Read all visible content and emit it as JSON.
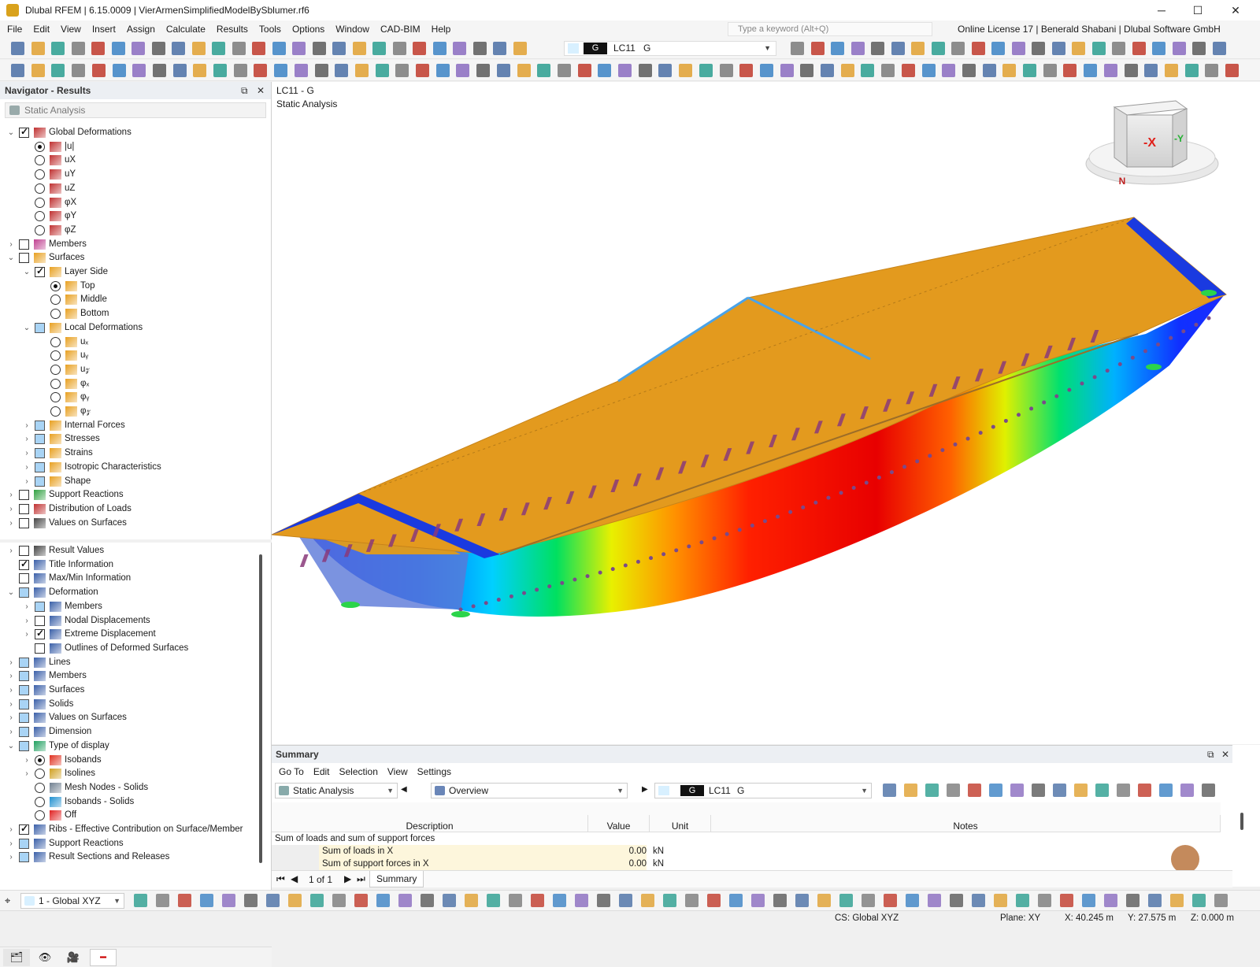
{
  "window": {
    "title": "Dlubal RFEM | 6.15.0009 | VierArmenSimplifiedModelBySblumer.rf6",
    "minimize": "─",
    "maximize": "☐",
    "close": "✕"
  },
  "menu": [
    "File",
    "Edit",
    "View",
    "Insert",
    "Assign",
    "Calculate",
    "Results",
    "Tools",
    "Options",
    "Window",
    "CAD-BIM",
    "Help"
  ],
  "search_placeholder": "Type a keyword (Alt+Q)",
  "license_text": "Online License 17 | Benerald Shabani | Dlubal Software GmbH",
  "toolbar": {
    "lc_color": "G",
    "lc_id": "LC11",
    "lc_name": "G"
  },
  "navigator": {
    "title": "Navigator - Results",
    "combo": "Static Analysis",
    "tree_top": [
      {
        "label": "Global Deformations",
        "level": 0,
        "exp": "v",
        "ctrl": "cb-on",
        "icon": "deformation-icon"
      },
      {
        "label": "|u|",
        "level": 1,
        "ctrl": "rb-on",
        "icon": "deformation-icon"
      },
      {
        "label": "uX",
        "level": 1,
        "ctrl": "rb",
        "icon": "deformation-icon"
      },
      {
        "label": "uY",
        "level": 1,
        "ctrl": "rb",
        "icon": "deformation-icon"
      },
      {
        "label": "uZ",
        "level": 1,
        "ctrl": "rb",
        "icon": "deformation-icon"
      },
      {
        "label": "φX",
        "level": 1,
        "ctrl": "rb",
        "icon": "deformation-icon"
      },
      {
        "label": "φY",
        "level": 1,
        "ctrl": "rb",
        "icon": "deformation-icon"
      },
      {
        "label": "φZ",
        "level": 1,
        "ctrl": "rb",
        "icon": "deformation-icon"
      },
      {
        "label": "Members",
        "level": 0,
        "exp": ">",
        "ctrl": "cb",
        "icon": "members-icon"
      },
      {
        "label": "Surfaces",
        "level": 0,
        "exp": "v",
        "ctrl": "cb",
        "icon": "surface-icon"
      },
      {
        "label": "Layer Side",
        "level": 1,
        "exp": "v",
        "ctrl": "cb-on",
        "icon": "surface-icon"
      },
      {
        "label": "Top",
        "level": 2,
        "ctrl": "rb-on",
        "icon": "surface-icon"
      },
      {
        "label": "Middle",
        "level": 2,
        "ctrl": "rb",
        "icon": "surface-icon"
      },
      {
        "label": "Bottom",
        "level": 2,
        "ctrl": "rb",
        "icon": "surface-icon"
      },
      {
        "label": "Local Deformations",
        "level": 1,
        "exp": "v",
        "ctrl": "cb-p",
        "icon": "surface-icon"
      },
      {
        "label": "uₓ",
        "level": 2,
        "ctrl": "rb",
        "icon": "surface-icon"
      },
      {
        "label": "uᵧ",
        "level": 2,
        "ctrl": "rb",
        "icon": "surface-icon"
      },
      {
        "label": "u𝓏",
        "level": 2,
        "ctrl": "rb",
        "icon": "surface-icon"
      },
      {
        "label": "φₓ",
        "level": 2,
        "ctrl": "rb",
        "icon": "surface-icon"
      },
      {
        "label": "φᵧ",
        "level": 2,
        "ctrl": "rb",
        "icon": "surface-icon"
      },
      {
        "label": "φ𝓏",
        "level": 2,
        "ctrl": "rb",
        "icon": "surface-icon"
      },
      {
        "label": "Internal Forces",
        "level": 1,
        "exp": ">",
        "ctrl": "cb-p",
        "icon": "surface-icon"
      },
      {
        "label": "Stresses",
        "level": 1,
        "exp": ">",
        "ctrl": "cb-p",
        "icon": "surface-icon"
      },
      {
        "label": "Strains",
        "level": 1,
        "exp": ">",
        "ctrl": "cb-p",
        "icon": "surface-icon"
      },
      {
        "label": "Isotropic Characteristics",
        "level": 1,
        "exp": ">",
        "ctrl": "cb-p",
        "icon": "surface-icon"
      },
      {
        "label": "Shape",
        "level": 1,
        "exp": ">",
        "ctrl": "cb-p",
        "icon": "surface-icon"
      },
      {
        "label": "Support Reactions",
        "level": 0,
        "exp": ">",
        "ctrl": "cb",
        "icon": "support-icon"
      },
      {
        "label": "Distribution of Loads",
        "level": 0,
        "exp": ">",
        "ctrl": "cb",
        "icon": "deformation-icon"
      },
      {
        "label": "Values on Surfaces",
        "level": 0,
        "exp": ">",
        "ctrl": "cb",
        "icon": "values-icon"
      }
    ],
    "tree_bottom": [
      {
        "label": "Result Values",
        "level": 0,
        "exp": ">",
        "ctrl": "cb",
        "icon": "values-icon"
      },
      {
        "label": "Title Information",
        "level": 0,
        "ctrl": "cb-on",
        "icon": "display-icon"
      },
      {
        "label": "Max/Min Information",
        "level": 0,
        "ctrl": "cb",
        "icon": "display-icon"
      },
      {
        "label": "Deformation",
        "level": 0,
        "exp": "v",
        "ctrl": "cb-p",
        "icon": "display-icon"
      },
      {
        "label": "Members",
        "level": 1,
        "exp": ">",
        "ctrl": "cb-p",
        "icon": "display-icon"
      },
      {
        "label": "Nodal Displacements",
        "level": 1,
        "exp": ">",
        "ctrl": "cb",
        "icon": "display-icon"
      },
      {
        "label": "Extreme Displacement",
        "level": 1,
        "exp": ">",
        "ctrl": "cb-on",
        "icon": "display-icon"
      },
      {
        "label": "Outlines of Deformed Surfaces",
        "level": 1,
        "ctrl": "cb",
        "icon": "display-icon"
      },
      {
        "label": "Lines",
        "level": 0,
        "exp": ">",
        "ctrl": "cb-p",
        "icon": "display-icon"
      },
      {
        "label": "Members",
        "level": 0,
        "exp": ">",
        "ctrl": "cb-p",
        "icon": "display-icon"
      },
      {
        "label": "Surfaces",
        "level": 0,
        "exp": ">",
        "ctrl": "cb-p",
        "icon": "display-icon"
      },
      {
        "label": "Solids",
        "level": 0,
        "exp": ">",
        "ctrl": "cb-p",
        "icon": "display-icon"
      },
      {
        "label": "Values on Surfaces",
        "level": 0,
        "exp": ">",
        "ctrl": "cb-p",
        "icon": "display-icon"
      },
      {
        "label": "Dimension",
        "level": 0,
        "exp": ">",
        "ctrl": "cb-p",
        "icon": "display-icon"
      },
      {
        "label": "Type of display",
        "level": 0,
        "exp": "v",
        "ctrl": "cb-p",
        "icon": "colorscale-icon"
      },
      {
        "label": "Isobands",
        "level": 1,
        "exp": ">",
        "ctrl": "rb-on",
        "icon": "isobands-icon"
      },
      {
        "label": "Isolines",
        "level": 1,
        "exp": ">",
        "ctrl": "rb",
        "icon": "isolines-icon"
      },
      {
        "label": "Mesh Nodes - Solids",
        "level": 1,
        "ctrl": "rb",
        "icon": "mesh-icon"
      },
      {
        "label": "Isobands - Solids",
        "level": 1,
        "ctrl": "rb",
        "icon": "isobands-solid-icon"
      },
      {
        "label": "Off",
        "level": 1,
        "ctrl": "rb",
        "icon": "off-icon"
      },
      {
        "label": "Ribs - Effective Contribution on Surface/Member",
        "level": 0,
        "exp": ">",
        "ctrl": "cb-on",
        "icon": "display-icon"
      },
      {
        "label": "Support Reactions",
        "level": 0,
        "exp": ">",
        "ctrl": "cb-p",
        "icon": "display-icon"
      },
      {
        "label": "Result Sections and Releases",
        "level": 0,
        "exp": ">",
        "ctrl": "cb-p",
        "icon": "display-icon"
      }
    ]
  },
  "viewport": {
    "title_line1": "LC11 - G",
    "title_line2": "Static Analysis",
    "cube": {
      "face_front": "-X",
      "face_side": "-Y",
      "north": "N"
    }
  },
  "summary": {
    "title": "Summary",
    "menu": [
      "Go To",
      "Edit",
      "Selection",
      "View",
      "Settings"
    ],
    "analysis_combo": "Static Analysis",
    "overview_combo": "Overview",
    "lc_color": "G",
    "lc_id": "LC11",
    "lc_name": "G",
    "columns": [
      "Description",
      "Value",
      "Unit",
      "Notes"
    ],
    "group": "Sum of loads and sum of support forces",
    "rows": [
      {
        "description": "Sum of loads in X",
        "value": "0.00",
        "unit": "kN",
        "notes": ""
      },
      {
        "description": "Sum of support forces in X",
        "value": "0.00",
        "unit": "kN",
        "notes": ""
      }
    ],
    "pager": "1 of 1",
    "sheet_tab": "Summary"
  },
  "bottom": {
    "cs_combo": "1 - Global XYZ"
  },
  "status": {
    "cs": "CS: Global XYZ",
    "plane": "Plane: XY",
    "x": "X: 40.245 m",
    "y": "Y: 27.575 m",
    "z": "Z: 0.000 m"
  },
  "colors": {
    "roof": "#e39a1e",
    "accent_blue": "#0078d7",
    "contour": [
      "#0000ff",
      "#00a0ff",
      "#00e000",
      "#ffff00",
      "#ff8000",
      "#ff0000"
    ]
  }
}
